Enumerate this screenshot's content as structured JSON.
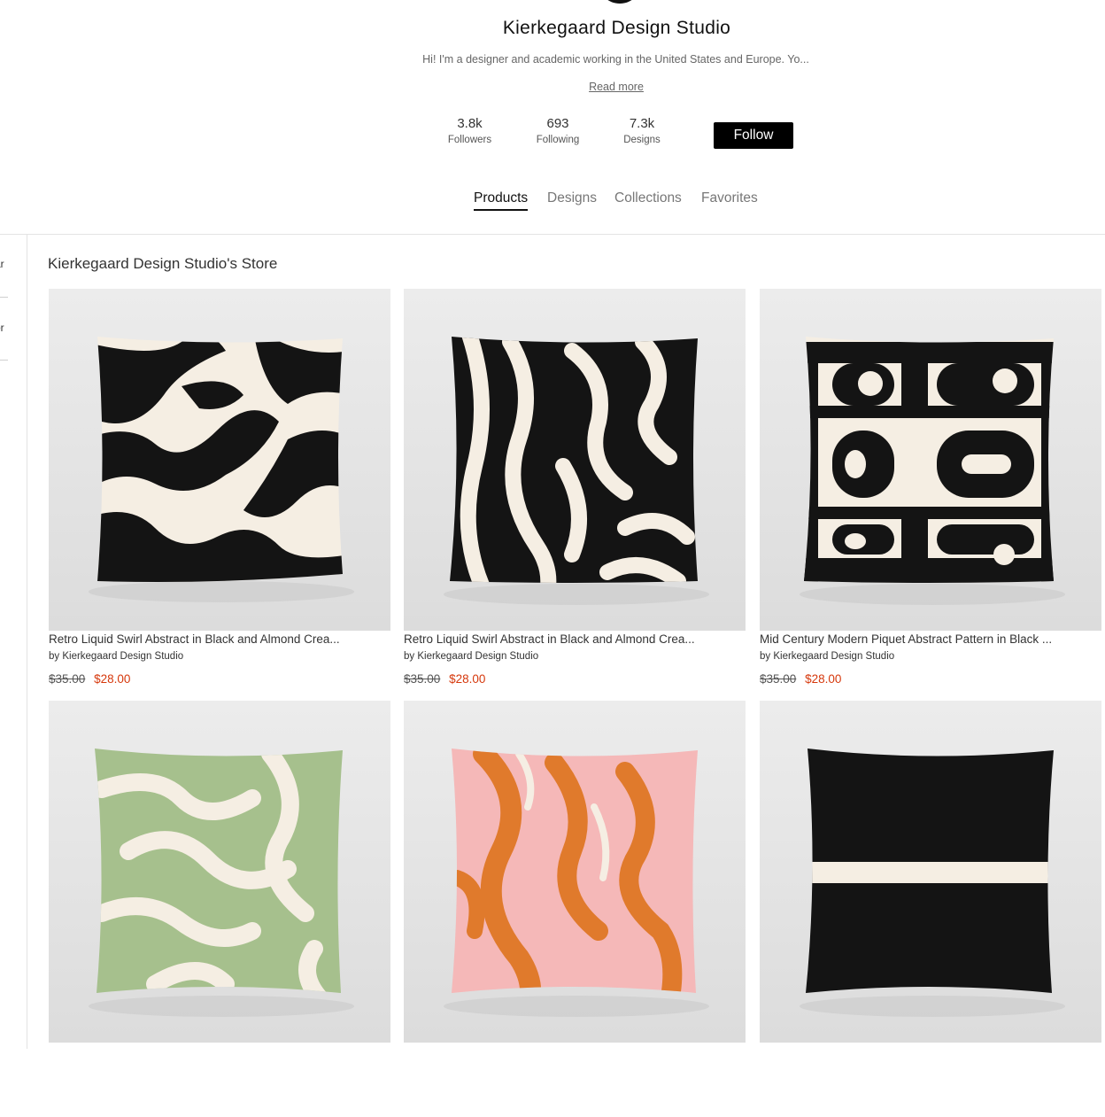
{
  "profile": {
    "name": "Kierkegaard Design Studio",
    "bio": "Hi! I'm a designer and academic working in the United States and Europe. Yo...",
    "read_more": "Read more",
    "stats": [
      {
        "value": "3.8k",
        "label": "Followers"
      },
      {
        "value": "693",
        "label": "Following"
      },
      {
        "value": "7.3k",
        "label": "Designs"
      }
    ],
    "follow_label": "Follow"
  },
  "tabs": [
    {
      "label": "Products",
      "active": true
    },
    {
      "label": "Designs",
      "active": false
    },
    {
      "label": "Collections",
      "active": false
    },
    {
      "label": "Favorites",
      "active": false
    }
  ],
  "sidebar": {
    "items": [
      {
        "label": "ar"
      },
      {
        "label": "or"
      }
    ]
  },
  "store": {
    "title": "Kierkegaard Design Studio's Store",
    "products": [
      {
        "title": "Retro Liquid Swirl Abstract in Black and Almond Crea...",
        "by": "by Kierkegaard Design Studio",
        "old_price": "$35.00",
        "price": "$28.00",
        "image": "black-almond-liquid-swirl-pillow"
      },
      {
        "title": "Retro Liquid Swirl Abstract in Black and Almond Crea...",
        "by": "by Kierkegaard Design Studio",
        "old_price": "$35.00",
        "price": "$28.00",
        "image": "black-almond-liquid-swirl-pillow-2"
      },
      {
        "title": "Mid Century Modern Piquet Abstract Pattern in Black ...",
        "by": "by Kierkegaard Design Studio",
        "old_price": "$35.00",
        "price": "$28.00",
        "image": "black-almond-piquet-pattern-pillow"
      },
      {
        "title": "",
        "by": "",
        "old_price": "",
        "price": "",
        "image": "sage-green-cream-swirl-pillow"
      },
      {
        "title": "",
        "by": "",
        "old_price": "",
        "price": "",
        "image": "orange-pink-liquid-swirl-pillow"
      },
      {
        "title": "",
        "by": "",
        "old_price": "",
        "price": "",
        "image": "black-with-cream-stripe-pillow"
      }
    ]
  },
  "colors": {
    "accent_sale": "#d6380c",
    "button_bg": "#000000",
    "pillow_black": "#141414",
    "pillow_cream": "#f5eee3",
    "pillow_sage": "#a6c08d",
    "pillow_orange": "#e07a2c",
    "pillow_pink": "#f5b8b8",
    "backdrop_grey": "#e7e7e7"
  }
}
